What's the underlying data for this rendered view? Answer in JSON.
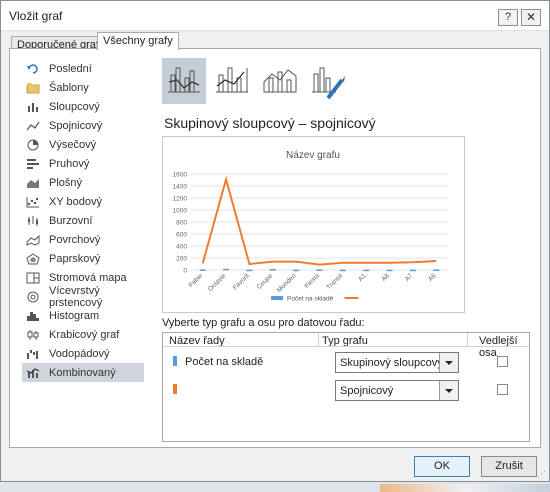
{
  "window": {
    "title": "Vložit graf",
    "help_label": "?",
    "close_label": "✕"
  },
  "tabs": [
    {
      "label": "Doporučené grafy",
      "active": false
    },
    {
      "label": "Všechny grafy",
      "active": true
    }
  ],
  "sidebar": {
    "items": [
      {
        "label": "Poslední",
        "icon": "recent-icon"
      },
      {
        "label": "Šablony",
        "icon": "folder-icon"
      },
      {
        "label": "Sloupcový",
        "icon": "column-chart-icon"
      },
      {
        "label": "Spojnicový",
        "icon": "line-chart-icon"
      },
      {
        "label": "Výsečový",
        "icon": "pie-chart-icon"
      },
      {
        "label": "Pruhový",
        "icon": "bar-chart-icon"
      },
      {
        "label": "Plošný",
        "icon": "area-chart-icon"
      },
      {
        "label": "XY bodový",
        "icon": "scatter-chart-icon"
      },
      {
        "label": "Burzovní",
        "icon": "stock-chart-icon"
      },
      {
        "label": "Povrchový",
        "icon": "surface-chart-icon"
      },
      {
        "label": "Paprskový",
        "icon": "radar-chart-icon"
      },
      {
        "label": "Stromová mapa",
        "icon": "treemap-icon"
      },
      {
        "label": "Vícevrstvý prstencový",
        "icon": "sunburst-icon"
      },
      {
        "label": "Histogram",
        "icon": "histogram-icon"
      },
      {
        "label": "Krabicový graf",
        "icon": "box-whisker-icon"
      },
      {
        "label": "Vodopádový",
        "icon": "waterfall-icon"
      },
      {
        "label": "Kombinovaný",
        "icon": "combo-chart-icon",
        "active": true
      }
    ]
  },
  "chart_subtypes": [
    {
      "icon": "combo-clustered-column-line-icon",
      "selected": true
    },
    {
      "icon": "combo-column-line-secondary-axis-icon",
      "selected": false
    },
    {
      "icon": "combo-stacked-area-column-icon",
      "selected": false
    },
    {
      "icon": "custom-combination-icon",
      "selected": false
    }
  ],
  "selected_type_title": "Skupinový sloupcový – spojnicový",
  "chart_data": {
    "type": "bar",
    "title": "Název grafu",
    "categories": [
      "Fabie",
      "Octavie",
      "Favorit",
      "Coupe",
      "Mondeo",
      "Fiesta",
      "Transit",
      "A1",
      "A8",
      "A7",
      "A6"
    ],
    "ylim": [
      0,
      1600
    ],
    "yticks": [
      0,
      200,
      400,
      600,
      800,
      1000,
      1200,
      1400,
      1600
    ],
    "grid": true,
    "legend_position": "bottom",
    "series": [
      {
        "name": "Počet na skladě",
        "type": "bar",
        "color": "#5b9bd5",
        "values": [
          10,
          20,
          5,
          15,
          5,
          10,
          5,
          5,
          5,
          5,
          10
        ]
      },
      {
        "name": "",
        "type": "line",
        "color": "#ed7d31",
        "values": [
          110,
          1510,
          100,
          140,
          140,
          90,
          120,
          120,
          120,
          130,
          150
        ]
      }
    ]
  },
  "series_config": {
    "instruction": "Vyberte typ grafu a osu pro datovou řadu:",
    "headers": {
      "name": "Název řady",
      "type": "Typ grafu",
      "secondary": "Vedlejší osa"
    },
    "rows": [
      {
        "name": "Počet na skladě",
        "color": "#5b9bd5",
        "chart_type": "Skupinový sloupcový",
        "secondary": false
      },
      {
        "name": "",
        "color": "#ed7d31",
        "chart_type": "Spojnicový",
        "secondary": false
      }
    ]
  },
  "buttons": {
    "ok": "OK",
    "cancel": "Zrušit"
  }
}
